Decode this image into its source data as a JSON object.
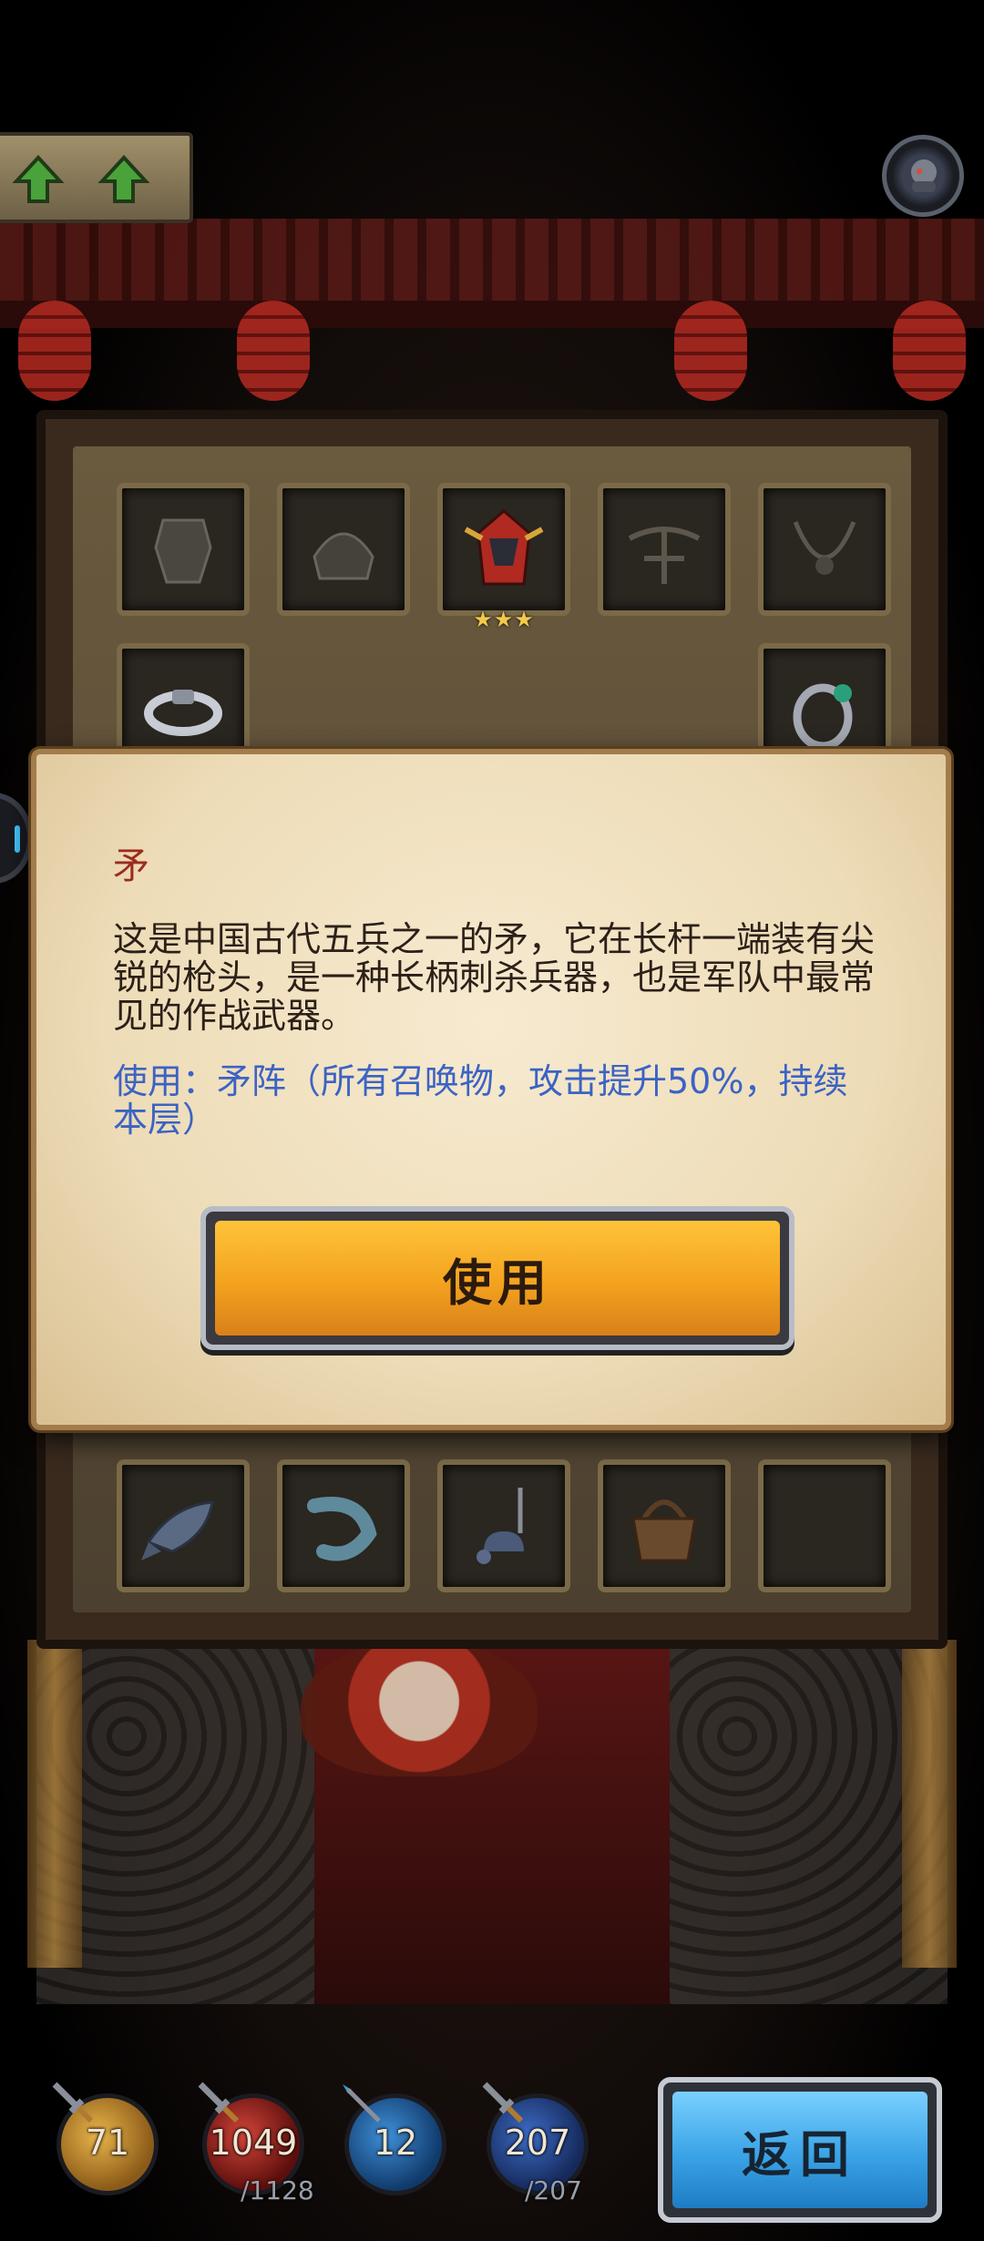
{
  "top_bar": {
    "arrow_buttons": [
      {
        "icon": "up-arrow-icon"
      },
      {
        "icon": "up-arrow-icon"
      }
    ],
    "portrait_icon": "hero-portrait-icon"
  },
  "inventory": {
    "top_row": [
      {
        "icon": "armor-icon",
        "locked": true
      },
      {
        "icon": "helmet-armor-icon",
        "locked": true
      },
      {
        "icon": "red-helmet-icon",
        "stars": "★★★"
      },
      {
        "icon": "crossbow-icon",
        "locked": true
      },
      {
        "icon": "necklace-icon",
        "locked": true
      }
    ],
    "second_row": [
      {
        "icon": "silver-ring-icon",
        "stars": "★"
      },
      {
        "icon": "dark-ring-icon",
        "stars": "★★"
      }
    ],
    "bottom_row": [
      {
        "icon": "fish-icon"
      },
      {
        "icon": "shrimp-icon"
      },
      {
        "icon": "bell-chain-icon"
      },
      {
        "icon": "basket-icon"
      },
      {
        "icon": "empty-slot"
      }
    ]
  },
  "dialog": {
    "title": "矛",
    "description": "这是中国古代五兵之一的矛，它在长杆一端装有尖锐的枪头，是一种长柄刺杀兵器，也是军队中最常见的作战武器。",
    "usage": "使用：矛阵（所有召唤物，攻击提升50%，持续本层）",
    "use_button_label": "使用"
  },
  "stats": {
    "attack": {
      "value": "71",
      "icon": "sword-icon"
    },
    "hp": {
      "value": "1049",
      "max": "/1128",
      "icon": "sword-icon"
    },
    "defense": {
      "value": "12",
      "icon": "spear-icon"
    },
    "mana": {
      "value": "207",
      "max": "/207",
      "icon": "sword-icon"
    }
  },
  "back_button_label": "返回",
  "colors": {
    "title_red": "#9a2b1f",
    "usage_blue": "#3b63c4",
    "use_button_gold": "#f3a21e",
    "back_button_blue": "#3aa3e6"
  }
}
